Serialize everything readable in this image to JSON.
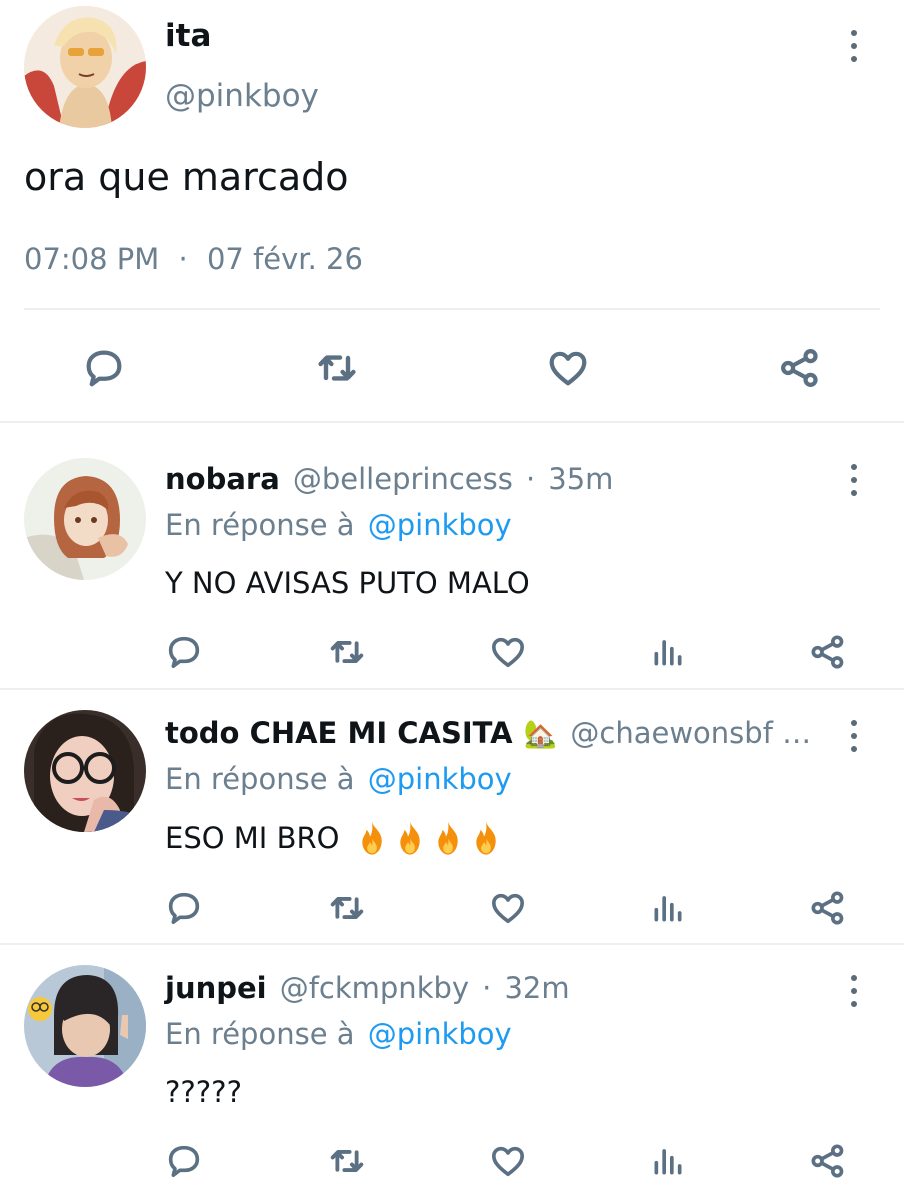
{
  "main_tweet": {
    "display_name": "ita",
    "handle": "@pinkboy",
    "text": "ora que marcado",
    "time": "07:08 PM",
    "separator": "·",
    "date": "07 févr. 26"
  },
  "replies": [
    {
      "display_name": "nobara",
      "handle": "@belleprincess",
      "separator": "·",
      "time": "35m",
      "reply_prefix": "En réponse à",
      "reply_to": "@pinkboy",
      "text": "Y NO AVISAS PUTO MALO"
    },
    {
      "display_name": "todo CHAE MI CASITA",
      "handle": "@chaewonsbf …",
      "emoji": "🏡",
      "reply_prefix": "En réponse à",
      "reply_to": "@pinkboy",
      "text": "ESO MI BRO",
      "fire_count": 4
    },
    {
      "display_name": "junpei",
      "handle": "@fckmpnkby",
      "separator": "·",
      "time": "32m",
      "reply_prefix": "En réponse à",
      "reply_to": "@pinkboy",
      "text": "?????"
    }
  ],
  "icons": {
    "reply": "reply-icon",
    "retweet": "retweet-icon",
    "like": "heart-icon",
    "views": "views-icon",
    "share": "share-icon",
    "more": "more-options-icon"
  },
  "colors": {
    "link": "#1d9bf0",
    "muted": "#6b7f8f",
    "icon": "#5b7083",
    "fire": "#f4900c"
  }
}
